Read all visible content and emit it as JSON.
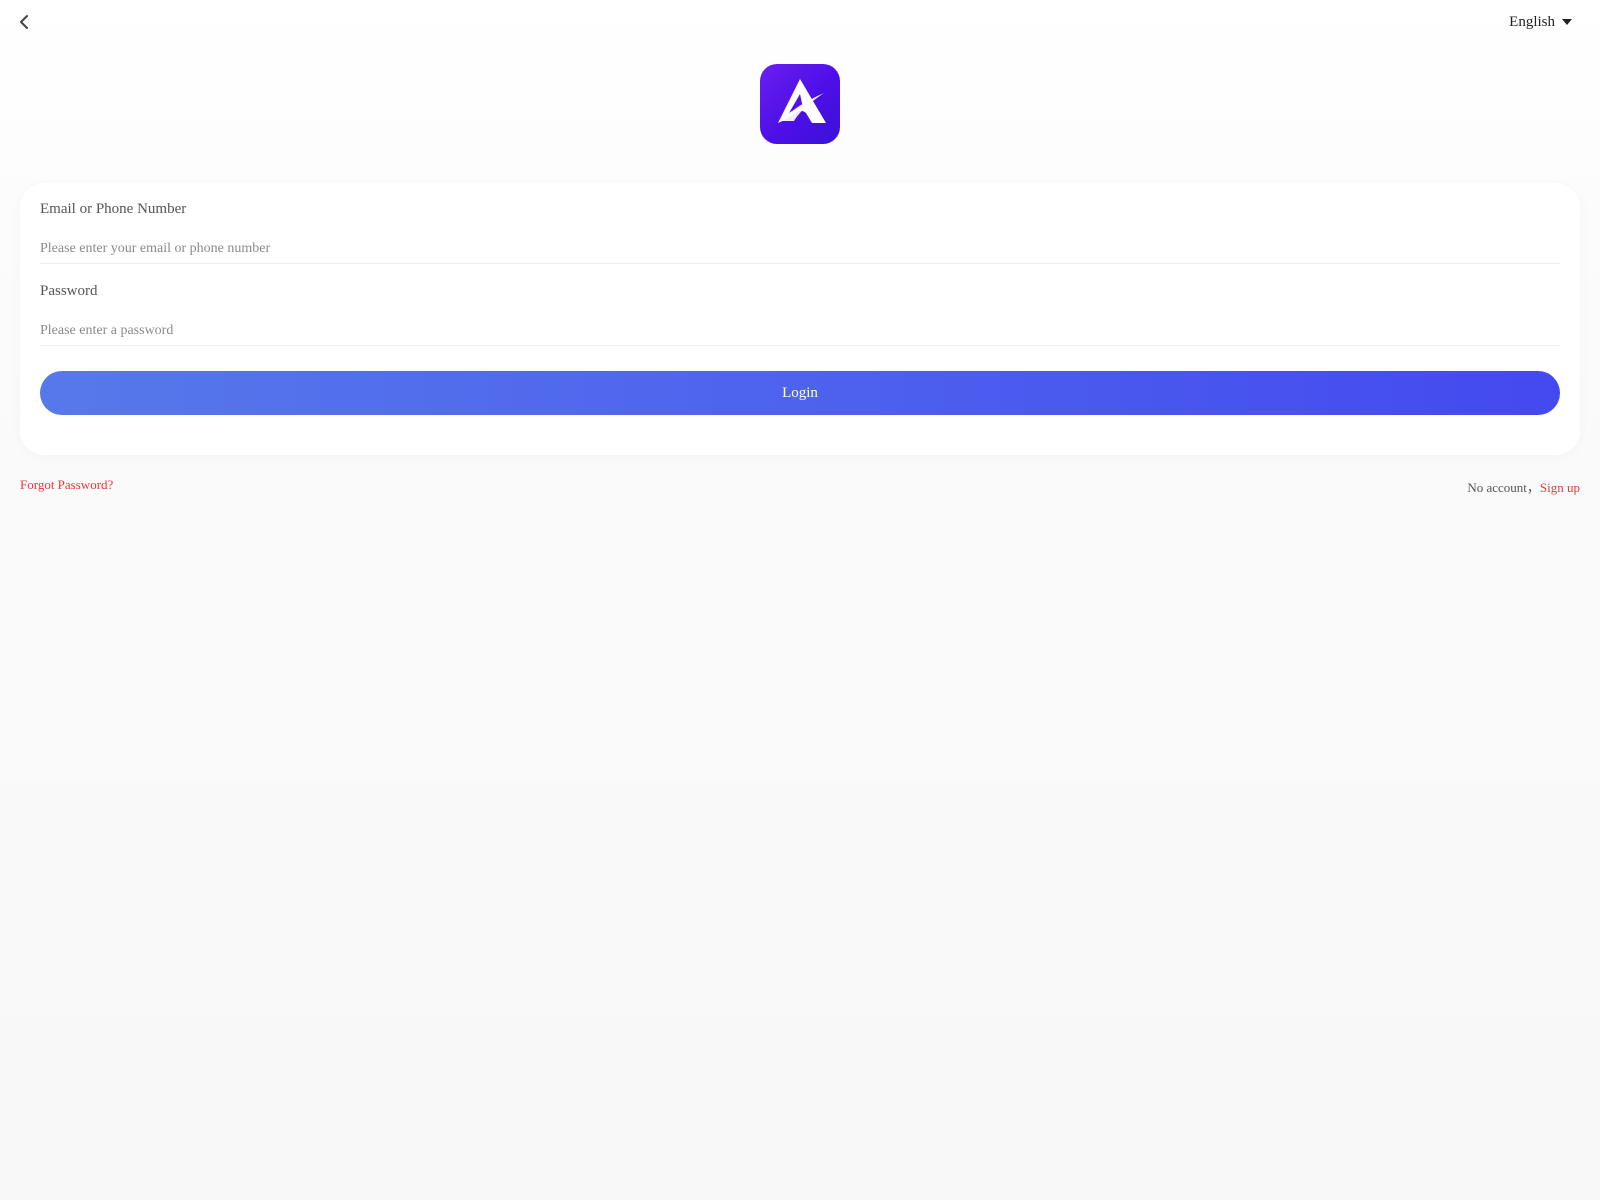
{
  "header": {
    "back_icon": "chevron-left-icon",
    "language": "English",
    "language_caret_icon": "caret-down-icon"
  },
  "logo": {
    "icon": "app-logo-icon",
    "color": "#5a17ec"
  },
  "form": {
    "email_label": "Email or Phone Number",
    "email_placeholder": "Please enter your email or phone number",
    "email_value": "",
    "password_label": "Password",
    "password_placeholder": "Please enter a password",
    "password_value": "",
    "login_label": "Login",
    "login_color": "#4d5cee"
  },
  "footer": {
    "forgot_password": "Forgot Password?",
    "no_account": "No account，",
    "sign_up": "Sign up",
    "link_color": "#e8373d"
  }
}
